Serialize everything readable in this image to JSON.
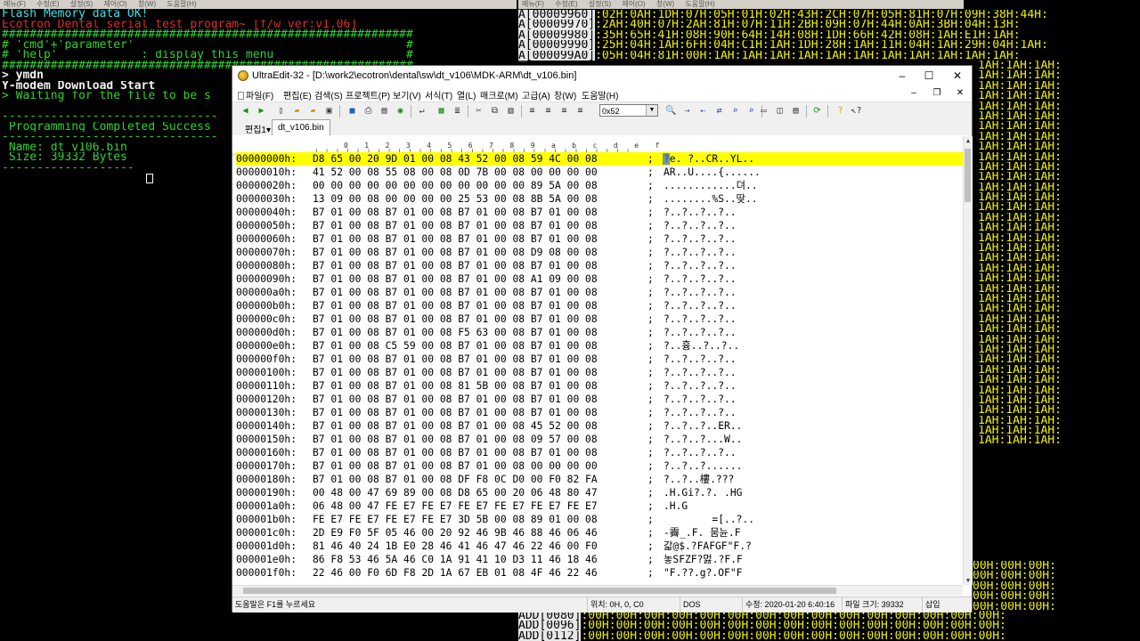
{
  "left_terminal": {
    "menu": [
      "메뉴(F)",
      "수정(E)",
      "설정(S)",
      "제어(O)",
      "창(W)",
      "도움말(H)"
    ],
    "lines": [
      {
        "text": "Flash Memory data OK!",
        "color": "cyan"
      },
      {
        "text": "Ecotron Dental serial test program~ [f/w_ver:v1.06]",
        "color": "red"
      },
      {
        "text": "###########################################################",
        "color": "green"
      },
      {
        "text": "# 'cmd'+'parameter'                                       #",
        "color": "green"
      },
      {
        "text": "# 'help'            : display this menu                   #",
        "color": "green"
      },
      {
        "text": "###########################################################",
        "color": "green"
      },
      {
        "text": "> ymdn",
        "color": "white"
      },
      {
        "text": "Y-modem Download Start",
        "color": "white"
      },
      {
        "text": "> Waiting for the file to be s",
        "color": "green"
      },
      {
        "text": "",
        "color": "green"
      },
      {
        "text": "-------------------------------",
        "color": "green"
      },
      {
        "text": " Programming Completed Success",
        "color": "green"
      },
      {
        "text": "-------------------------------",
        "color": "green"
      },
      {
        "text": " Name: dt_v106.bin",
        "color": "green"
      },
      {
        "text": " Size: 39332 Bytes",
        "color": "green"
      },
      {
        "text": "-------------------",
        "color": "green"
      }
    ]
  },
  "right_terminal": {
    "menu": [
      "메뉴(F)",
      "수정(E)",
      "설정(S)",
      "제어(O)",
      "창(W)",
      "도움말(H)"
    ],
    "top_lines": [
      {
        "addr": "A[00009960]",
        "data": ":02H:0AH:1DH:07H:05H:01H:02H:43H:2CH:07H:05H:81H:07H:09H:38H:44H:"
      },
      {
        "addr": "A[00009970]",
        "data": ":2AH:40H:07H:2AH:81H:07H:11H:2BH:09H:07H:44H:0AH:3BH:04H:13H:"
      },
      {
        "addr": "A[00009980]",
        "data": ":35H:65H:41H:08H:90H:64H:14H:08H:1DH:66H:42H:08H:1AH:E1H:1AH:"
      },
      {
        "addr": "A[00009990]",
        "data": ":25H:04H:1AH:6FH:04H:C1H:1AH:1DH:28H:1AH:11H:04H:1AH:29H:04H:1AH:"
      },
      {
        "addr": "A[000099A0]",
        "data": ":05H:04H:81H:00H:1AH:1AH:1AH:1AH:1AH:1AH:1AH:1AH:1AH:1AH:1AH:"
      }
    ],
    "column_lines": [
      "1AH:1AH:1AH:",
      "1AH:1AH:1AH:",
      "1AH:1AH:1AH:",
      "1AH:1AH:1AH:",
      "1AH:1AH:1AH:",
      "1AH:1AH:1AH:",
      "1AH:1AH:1AH:",
      "1AH:1AH:1AH:",
      "1AH:1AH:1AH:",
      "1AH:1AH:1AH:",
      "1AH:1AH:1AH:",
      "1AH:1AH:1AH:",
      "1AH:1AH:1AH:",
      "1AH:1AH:1AH:",
      "1AH:1AH:1AH:",
      "1AH:1AH:1AH:",
      "1AH:1AH:1AH:",
      "1AH:1AH:1AH:",
      "1AH:1AH:1AH:",
      "1AH:1AH:1AH:",
      "1AH:1AH:1AH:",
      "1AH:1AH:1AH:",
      "1AH:1AH:1AH:",
      "1AH:1AH:1AH:",
      "1AH:1AH:1AH:",
      "1AH:1AH:1AH:",
      "1AH:1AH:1AH:",
      "1AH:1AH:1AH:",
      "1AH:1AH:1AH:",
      "1AH:1AH:1AH:",
      "1AH:1AH:1AH:",
      "1AH:1AH:1AH:",
      "1AH:1AH:1AH:",
      "1AH:1AH:1AH:",
      "1AH:1AH:1AH:",
      "1AH:1AH:1AH:",
      "1AH:1AH:1AH:",
      "1AH:1AH:1AH:"
    ],
    "column_lines2": [
      "00H:00H:00H:",
      "00H:00H:00H:",
      "00H:00H:00H:",
      "00H:00H:00H:",
      "00H:00H:00H:"
    ],
    "bottom_lines": [
      {
        "addr": "ADD[0080]",
        "data": ":00H:00H:00H:00H:00H:00H:00H:00H:00H:00H:00H:00H:00H:00H:00H:"
      },
      {
        "addr": "ADD[0096]",
        "data": ":00H:00H:00H:00H:00H:00H:00H:00H:00H:00H:00H:00H:00H:00H:00H:"
      },
      {
        "addr": "ADD[0112]",
        "data": ":00H:00H:00H:00H:00H:00H:00H:00H:00H:00H:00H:00H:00H:00H:00H:"
      }
    ]
  },
  "ultraedit": {
    "title": "UltraEdit-32 - [D:\\work2\\ecotron\\dental\\sw\\dt_v106\\MDK-ARM\\dt_v106.bin]",
    "window_buttons": {
      "minimize": "–",
      "maximize": "☐",
      "close": "✕"
    },
    "mdi_buttons": {
      "minimize": "–",
      "restore": "❐",
      "close": "✕"
    },
    "menu": [
      "파일(F)",
      "편집(E)",
      "검색(S)",
      "프로젝트(P)",
      "보기(V)",
      "서식(T)",
      "열(L)",
      "매크로(M)",
      "고급(A)",
      "창(W)",
      "도움말(H)"
    ],
    "toolbar_combo": "0x52",
    "tab_menu": "편집1▾",
    "tab_file": "dt_v106.bin",
    "ruler": [
      "0",
      "1",
      "2",
      "3",
      "4",
      "5",
      "6",
      "7",
      "8",
      "9",
      "a",
      "b",
      "c",
      "d",
      "e",
      "f"
    ],
    "hex_rows": [
      {
        "offset": "00000000h:",
        "bytes": "D8 65 00 20 9D 01 00 08 43 52 00 08 59 4C 00 08",
        "ascii": "?e. ?..CR..YL..",
        "selected": true
      },
      {
        "offset": "00000010h:",
        "bytes": "41 52 00 08 55 08 00 08 0D 7B 00 08 00 00 00 00",
        "ascii": "AR..U....{......"
      },
      {
        "offset": "00000020h:",
        "bytes": "00 00 00 00 00 00 00 00 00 00 00 00 89 5A 00 08",
        "ascii": "............뎌.."
      },
      {
        "offset": "00000030h:",
        "bytes": "13 09 00 08 00 00 00 00 25 53 00 08 8B 5A 00 08",
        "ascii": "........%S..땆.."
      },
      {
        "offset": "00000040h:",
        "bytes": "B7 01 00 08 B7 01 00 08 B7 01 00 08 B7 01 00 08",
        "ascii": "?..?..?..?.."
      },
      {
        "offset": "00000050h:",
        "bytes": "B7 01 00 08 B7 01 00 08 B7 01 00 08 B7 01 00 08",
        "ascii": "?..?..?..?.."
      },
      {
        "offset": "00000060h:",
        "bytes": "B7 01 00 08 B7 01 00 08 B7 01 00 08 B7 01 00 08",
        "ascii": "?..?..?..?.."
      },
      {
        "offset": "00000070h:",
        "bytes": "B7 01 00 08 B7 01 00 08 B7 01 00 08 D9 08 00 08",
        "ascii": "?..?..?..?.."
      },
      {
        "offset": "00000080h:",
        "bytes": "B7 01 00 08 B7 01 00 08 B7 01 00 08 B7 01 00 08",
        "ascii": "?..?..?..?.."
      },
      {
        "offset": "00000090h:",
        "bytes": "B7 01 00 08 B7 01 00 08 B7 01 00 08 A1 09 00 08",
        "ascii": "?..?..?..?.."
      },
      {
        "offset": "000000a0h:",
        "bytes": "B7 01 00 08 B7 01 00 08 B7 01 00 08 B7 01 00 08",
        "ascii": "?..?..?..?.."
      },
      {
        "offset": "000000b0h:",
        "bytes": "B7 01 00 08 B7 01 00 08 B7 01 00 08 B7 01 00 08",
        "ascii": "?..?..?..?.."
      },
      {
        "offset": "000000c0h:",
        "bytes": "B7 01 00 08 B7 01 00 08 B7 01 00 08 B7 01 00 08",
        "ascii": "?..?..?..?.."
      },
      {
        "offset": "000000d0h:",
        "bytes": "B7 01 00 08 B7 01 00 08 F5 63 00 08 B7 01 00 08",
        "ascii": "?..?..?..?.."
      },
      {
        "offset": "000000e0h:",
        "bytes": "B7 01 00 08 C5 59 00 08 B7 01 00 08 B7 01 00 08",
        "ascii": "?..흉..?..?.."
      },
      {
        "offset": "000000f0h:",
        "bytes": "B7 01 00 08 B7 01 00 08 B7 01 00 08 B7 01 00 08",
        "ascii": "?..?..?..?.."
      },
      {
        "offset": "00000100h:",
        "bytes": "B7 01 00 08 B7 01 00 08 B7 01 00 08 B7 01 00 08",
        "ascii": "?..?..?..?.."
      },
      {
        "offset": "00000110h:",
        "bytes": "B7 01 00 08 B7 01 00 08 81 5B 00 08 B7 01 00 08",
        "ascii": "?..?..?..?.."
      },
      {
        "offset": "00000120h:",
        "bytes": "B7 01 00 08 B7 01 00 08 B7 01 00 08 B7 01 00 08",
        "ascii": "?..?..?..?.."
      },
      {
        "offset": "00000130h:",
        "bytes": "B7 01 00 08 B7 01 00 08 B7 01 00 08 B7 01 00 08",
        "ascii": "?..?..?..?.."
      },
      {
        "offset": "00000140h:",
        "bytes": "B7 01 00 08 B7 01 00 08 B7 01 00 08 45 52 00 08",
        "ascii": "?..?..?..ER.."
      },
      {
        "offset": "00000150h:",
        "bytes": "B7 01 00 08 B7 01 00 08 B7 01 00 08 09 57 00 08",
        "ascii": "?..?..?...W.."
      },
      {
        "offset": "00000160h:",
        "bytes": "B7 01 00 08 B7 01 00 08 B7 01 00 08 B7 01 00 08",
        "ascii": "?..?..?..?.."
      },
      {
        "offset": "00000170h:",
        "bytes": "B7 01 00 08 B7 01 00 08 B7 01 00 08 00 00 00 00",
        "ascii": "?..?..?......"
      },
      {
        "offset": "00000180h:",
        "bytes": "B7 01 00 08 B7 01 00 08 DF F8 0C D0 00 F0 82 FA",
        "ascii": "?..?..樓.???"
      },
      {
        "offset": "00000190h:",
        "bytes": "00 48 00 47 69 89 00 08 D8 65 00 20 06 48 80 47",
        "ascii": ".H.Gi?.?. .HG"
      },
      {
        "offset": "000001a0h:",
        "bytes": "06 48 00 47 FE E7 FE E7 FE E7 FE E7 FE E7 FE E7",
        "ascii": ".H.G"
      },
      {
        "offset": "000001b0h:",
        "bytes": "FE E7 FE E7 FE E7 FE E7 3D 5B 00 08 89 01 00 08",
        "ascii": "        =[..?.."
      },
      {
        "offset": "000001c0h:",
        "bytes": "2D E9 F0 5F 05 46 00 20 92 46 9B 46 88 46 06 46",
        "ascii": "-霽_.F. 뭄뉸.F"
      },
      {
        "offset": "000001d0h:",
        "bytes": "81 46 40 24 1B E0 28 46 41 46 47 46 22 46 00 F0",
        "ascii": "갋@$.?FAFGF\"F.?"
      },
      {
        "offset": "000001e0h:",
        "bytes": "86 F8 53 46 5A 46 C0 1A 91 41 10 D3 11 46 18 46",
        "ascii": "놓SFZF?멇.?F.F"
      },
      {
        "offset": "000001f0h:",
        "bytes": "22 46 00 F0 6D F8 2D 1A 67 EB 01 08 4F 46 22 46",
        "ascii": "\"F.??.g?.OF\"F"
      }
    ],
    "status": {
      "help": "도움말은 F1를 누르세요",
      "position": "위치: 0H, 0, C0",
      "format": "DOS",
      "modified": "수정: 2020-01-20 6:40:16",
      "filesize": "파일 크기: 39332",
      "mode": "삽입"
    }
  }
}
